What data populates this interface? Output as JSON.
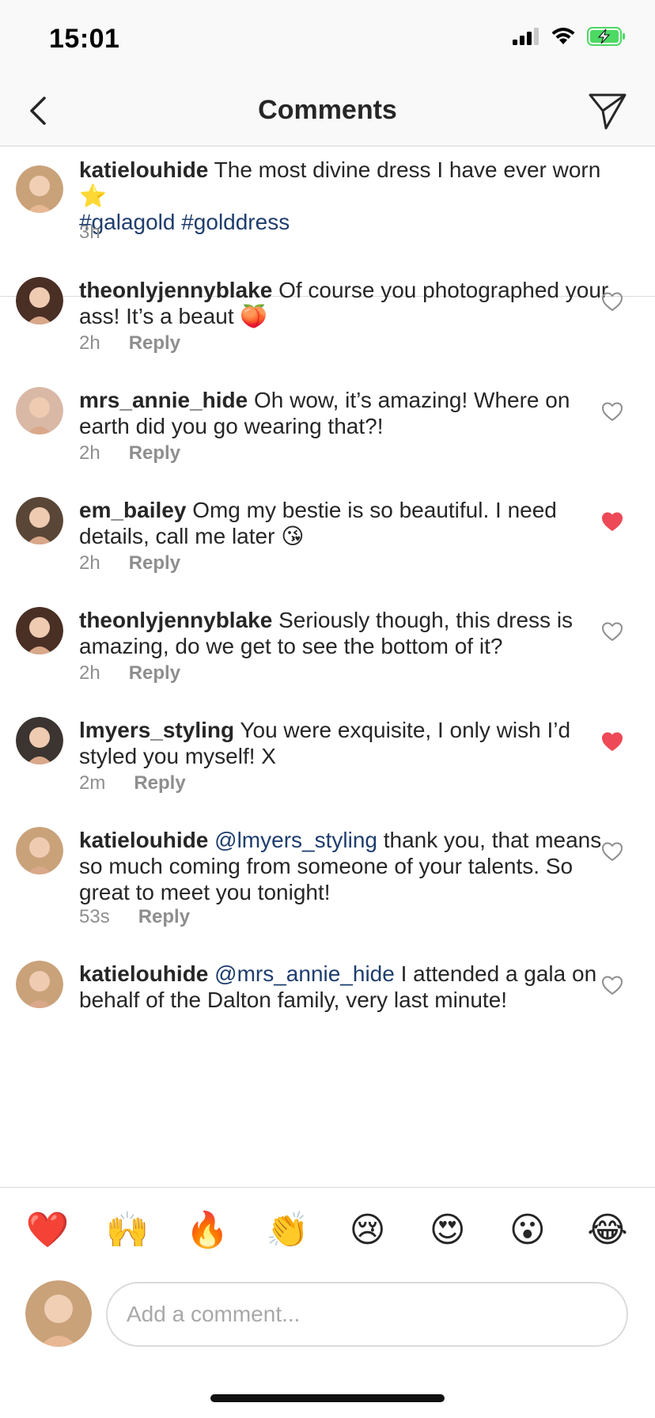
{
  "status_bar": {
    "time": "15:01"
  },
  "header": {
    "title": "Comments"
  },
  "caption": {
    "username": "katielouhide",
    "text": "The most divine dress I have ever worn",
    "star_emoji": "⭐",
    "hashtags": "#galagold #golddress",
    "time": "3h",
    "avatar_color": "#c9a27a"
  },
  "comments": [
    {
      "username": "theonlyjennyblake",
      "text": "Of course you photographed your ass! It’s a beaut 🍑",
      "time": "2h",
      "reply_label": "Reply",
      "liked": false,
      "avatar_color": "#4a2f25"
    },
    {
      "username": "mrs_annie_hide",
      "text": "Oh wow, it’s amazing! Where on earth did you go wearing that?!",
      "time": "2h",
      "reply_label": "Reply",
      "liked": false,
      "avatar_color": "#d9b8a6"
    },
    {
      "username": "em_bailey",
      "text": "Omg my bestie is so beautiful. I need details, call me later 😘",
      "time": "2h",
      "reply_label": "Reply",
      "liked": true,
      "avatar_color": "#5a4636"
    },
    {
      "username": "theonlyjennyblake",
      "text": "Seriously though, this dress is amazing, do we get to see the bottom of it?",
      "time": "2h",
      "reply_label": "Reply",
      "liked": false,
      "avatar_color": "#4a2f25"
    },
    {
      "username": "lmyers_styling",
      "text": "You were exquisite, I only wish I’d styled you myself! X",
      "time": "2m",
      "reply_label": "Reply",
      "liked": true,
      "avatar_color": "#3b3430"
    },
    {
      "username": "katielouhide",
      "mention": "@lmyers_styling",
      "text": "thank you, that means so much coming from someone of your talents. So great to meet you tonight!",
      "time": "53s",
      "reply_label": "Reply",
      "liked": false,
      "avatar_color": "#c9a27a"
    },
    {
      "username": "katielouhide",
      "mention": "@mrs_annie_hide",
      "text": "I attended a gala on behalf of the Dalton family, very last minute!",
      "liked": false,
      "avatar_color": "#c9a27a"
    }
  ],
  "emoji_bar": [
    "❤️",
    "🙌",
    "🔥",
    "👏",
    "😢",
    "😍",
    "😮",
    "😂"
  ],
  "input": {
    "placeholder": "Add a comment..."
  },
  "colors": {
    "like_red": "#ed4956",
    "link_blue": "#1e3d6e",
    "meta_gray": "#8e8e8e",
    "battery_green": "#4cd964"
  }
}
